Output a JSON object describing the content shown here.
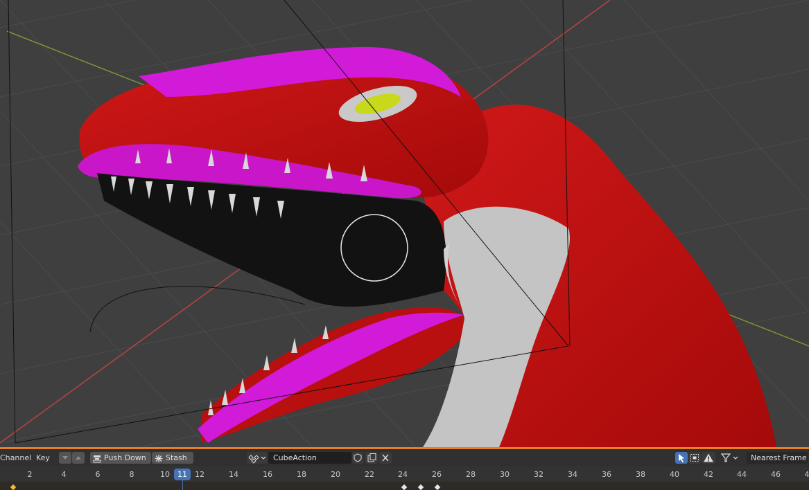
{
  "viewport": {
    "scene": "3D viewport showing a red dinosaur head model with open mouth, magenta stripe, grey claws",
    "colors": {
      "background": "#3f3f3f",
      "grid": "#4a4a4a",
      "x_axis": "#c64a4a",
      "y_axis": "#7a9a3a",
      "model_red": "#c91010",
      "model_magenta": "#d21ad9",
      "model_grey": "#c4c4c4",
      "eye": "#c8d81a"
    }
  },
  "header": {
    "channel_label": "Channel",
    "key_label": "Key",
    "push_down_label": "Push Down",
    "stash_label": "Stash",
    "action_name": "CubeAction",
    "snap_label": "Nearest Frame",
    "icons": [
      "arrow-down-icon",
      "arrow-up-icon",
      "push-down-icon",
      "stash-icon",
      "action-icon",
      "shield-icon",
      "duplicate-icon",
      "close-icon",
      "select-cursor-icon",
      "box-select-icon",
      "warning-icon",
      "filter-icon",
      "chevron-down-icon"
    ],
    "accent_color": "#4772b3"
  },
  "timeline": {
    "frame_labels": [
      "2",
      "4",
      "6",
      "8",
      "10",
      "12",
      "14",
      "16",
      "18",
      "20",
      "22",
      "24",
      "26",
      "28",
      "30",
      "32",
      "34",
      "36",
      "38",
      "40",
      "42",
      "44",
      "46",
      "4"
    ],
    "current_frame": "11",
    "divider_color": "#e8801e"
  }
}
